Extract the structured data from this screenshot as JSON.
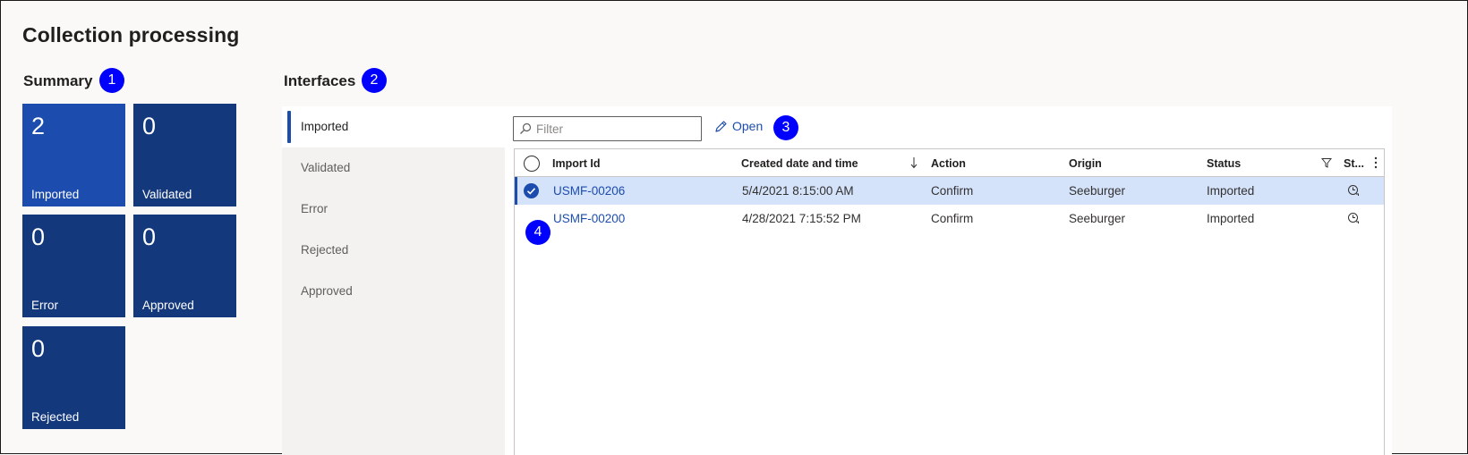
{
  "page": {
    "title": "Collection processing"
  },
  "summary": {
    "title": "Summary",
    "callout": "1",
    "tiles": [
      {
        "count": "2",
        "label": "Imported"
      },
      {
        "count": "0",
        "label": "Validated"
      },
      {
        "count": "0",
        "label": "Error"
      },
      {
        "count": "0",
        "label": "Approved"
      },
      {
        "count": "0",
        "label": "Rejected"
      }
    ]
  },
  "interfaces": {
    "title": "Interfaces",
    "callout": "2",
    "nav": [
      {
        "label": "Imported",
        "selected": true
      },
      {
        "label": "Validated"
      },
      {
        "label": "Error"
      },
      {
        "label": "Rejected"
      },
      {
        "label": "Approved"
      }
    ]
  },
  "toolbar": {
    "filter_placeholder": "Filter",
    "filter_icon": "search-icon",
    "open_label": "Open",
    "open_icon": "pencil-icon",
    "callout": "3"
  },
  "grid": {
    "columns": {
      "import_id": "Import Id",
      "created": "Created date and time",
      "action": "Action",
      "origin": "Origin",
      "status": "Status",
      "st": "St..."
    },
    "rows": [
      {
        "import_id": "USMF-00206",
        "created": "5/4/2021 8:15:00 AM",
        "action": "Confirm",
        "origin": "Seeburger",
        "status": "Imported",
        "selected": true
      },
      {
        "import_id": "USMF-00200",
        "created": "4/28/2021 7:15:52 PM",
        "action": "Confirm",
        "origin": "Seeburger",
        "status": "Imported",
        "selected": false
      }
    ],
    "callout": "4"
  },
  "colors": {
    "tile": "#13387c",
    "tile_active": "#1c4dae",
    "accent": "#1c4dae",
    "callout": "#0000ff",
    "selected_row": "#d4e2fa"
  }
}
